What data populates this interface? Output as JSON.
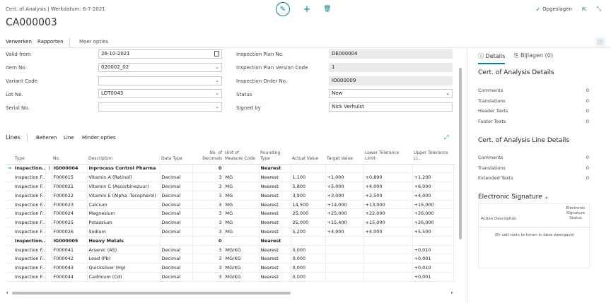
{
  "header": {
    "breadcrumb": "Cert. of Analysis | Werkdatum: 6-7-2021",
    "title": "CA000003",
    "saved_label": "Opgeslagen"
  },
  "actions": {
    "process": "Verwerken",
    "reports": "Rapporten",
    "more": "Meer opties"
  },
  "form": {
    "valid_from": {
      "label": "Valid from",
      "value": "26-10-2021"
    },
    "item_no": {
      "label": "Item No.",
      "value": "020002_02"
    },
    "variant_code": {
      "label": "Variant Code",
      "value": ""
    },
    "lot_no": {
      "label": "Lot No.",
      "value": "LOT0043"
    },
    "serial_no": {
      "label": "Serial No.",
      "value": ""
    },
    "inspection_plan_no": {
      "label": "Inspection Plan No.",
      "value": "DE000004"
    },
    "inspection_plan_version": {
      "label": "Inspection Plan Version Code",
      "value": "1"
    },
    "inspection_order_no": {
      "label": "Inspection Order No.",
      "value": "IO000009"
    },
    "status": {
      "label": "Status",
      "value": "New"
    },
    "signed_by": {
      "label": "Signed by",
      "value": "Nick Verhulst"
    }
  },
  "lines": {
    "title": "Lines",
    "manage": "Beheren",
    "line": "Line",
    "fewer": "Minder opties",
    "columns": [
      "Type",
      "No.",
      "Description",
      "Data Type",
      "No. of Decimals",
      "Unit of Measure Code",
      "Rounding Type",
      "Actual Value",
      "Target Value",
      "Lower Tolerance Limit",
      "Upper Tolerance Li..."
    ],
    "rows": [
      {
        "type": "Inspection...",
        "no": "IG000004",
        "desc": "Inprocess Control Pharma",
        "dtype": "",
        "dec": "0",
        "uom": "",
        "round": "Nearest",
        "actual": "",
        "target": "",
        "lower": "",
        "upper": "",
        "bold": true,
        "selected": true
      },
      {
        "type": "Inspection F...",
        "no": "F000015",
        "desc": "Vitamin A (Retinol)",
        "dtype": "Decimal",
        "dec": "3",
        "uom": "MG",
        "round": "Nearest",
        "actual": "1,100",
        "target": "+1,000",
        "lower": "+0,890",
        "upper": "+1,200"
      },
      {
        "type": "Inspection F...",
        "no": "F000021",
        "desc": "Vitamin C (Ascorbinezuur)",
        "dtype": "Decimal",
        "dec": "3",
        "uom": "MG",
        "round": "Nearest",
        "actual": "5,800",
        "target": "+5,000",
        "lower": "+4,000",
        "upper": "+6,000"
      },
      {
        "type": "Inspection F...",
        "no": "F000022",
        "desc": "Vitamin E (Alpha -Tocopherol)",
        "dtype": "Decimal",
        "dec": "3",
        "uom": "MG",
        "round": "Nearest",
        "actual": "3,900",
        "target": "+3,000",
        "lower": "+2,500",
        "upper": "+4,000"
      },
      {
        "type": "Inspection F...",
        "no": "F000023",
        "desc": "Calcium",
        "dtype": "Decimal",
        "dec": "3",
        "uom": "MG",
        "round": "Nearest",
        "actual": "14,500",
        "target": "+14,000",
        "lower": "+13,000",
        "upper": "+15,000"
      },
      {
        "type": "Inspection F...",
        "no": "F000024",
        "desc": "Magnesium",
        "dtype": "Decimal",
        "dec": "3",
        "uom": "MG",
        "round": "Nearest",
        "actual": "25,000",
        "target": "+25,000",
        "lower": "+22,000",
        "upper": "+26,000"
      },
      {
        "type": "Inspection F...",
        "no": "F000025",
        "desc": "Potassium",
        "dtype": "Decimal",
        "dec": "3",
        "uom": "MG",
        "round": "Nearest",
        "actual": "25,000",
        "target": "+15,400",
        "lower": "+15,000",
        "upper": "+26,000"
      },
      {
        "type": "Inspection F...",
        "no": "F000026",
        "desc": "Sodium",
        "dtype": "Decimal",
        "dec": "3",
        "uom": "MG",
        "round": "Nearest",
        "actual": "5,200",
        "target": "+4,900",
        "lower": "+4,000",
        "upper": "+5,500"
      },
      {
        "type": "Inspection...",
        "no": "IG000005",
        "desc": "Heavy Metals",
        "dtype": "",
        "dec": "0",
        "uom": "",
        "round": "Nearest",
        "actual": "",
        "target": "",
        "lower": "",
        "upper": "",
        "bold": true
      },
      {
        "type": "Inspection F...",
        "no": "F000041",
        "desc": "Arsenic (AS)",
        "dtype": "Decimal",
        "dec": "3",
        "uom": "MG/KG",
        "round": "Nearest",
        "actual": "0,000",
        "target": "",
        "lower": "",
        "upper": "+0,010"
      },
      {
        "type": "Inspection F...",
        "no": "F000042",
        "desc": "Lead (Pb)",
        "dtype": "Decimal",
        "dec": "3",
        "uom": "MG/KG",
        "round": "Nearest",
        "actual": "0,000",
        "target": "",
        "lower": "",
        "upper": "+0,001"
      },
      {
        "type": "Inspection F...",
        "no": "F000043",
        "desc": "Quicksilver (Hg)",
        "dtype": "Decimal",
        "dec": "3",
        "uom": "MG/KG",
        "round": "Nearest",
        "actual": "0,000",
        "target": "",
        "lower": "",
        "upper": "+0,010"
      },
      {
        "type": "Inspection F...",
        "no": "F000044",
        "desc": "Cadmium (Cd)",
        "dtype": "Decimal",
        "dec": "3",
        "uom": "MG/KG",
        "round": "Nearest",
        "actual": "0,000",
        "target": "",
        "lower": "",
        "upper": "+0,001"
      }
    ]
  },
  "factbox": {
    "tab_details": "Details",
    "tab_attachments": "Bijlagen (0)",
    "cert_heading": "Cert. of Analysis Details",
    "cert_rows": [
      {
        "label": "Comments",
        "value": "0"
      },
      {
        "label": "Translations",
        "value": "0"
      },
      {
        "label": "Header Texts",
        "value": "0"
      },
      {
        "label": "Footer Texts",
        "value": "0"
      }
    ],
    "line_heading": "Cert. of Analysis Line Details",
    "line_rows": [
      {
        "label": "Comments",
        "value": "0"
      },
      {
        "label": "Translations",
        "value": "0"
      },
      {
        "label": "Extended Texts",
        "value": "0"
      }
    ],
    "sig_heading": "Electronic Signature",
    "sig_col_action": "Action Description",
    "sig_col_status": "Electronic Signature Status",
    "sig_empty": "(Er valt niets te tonen in deze weergave)"
  },
  "colors": {
    "accent": "#008489"
  }
}
